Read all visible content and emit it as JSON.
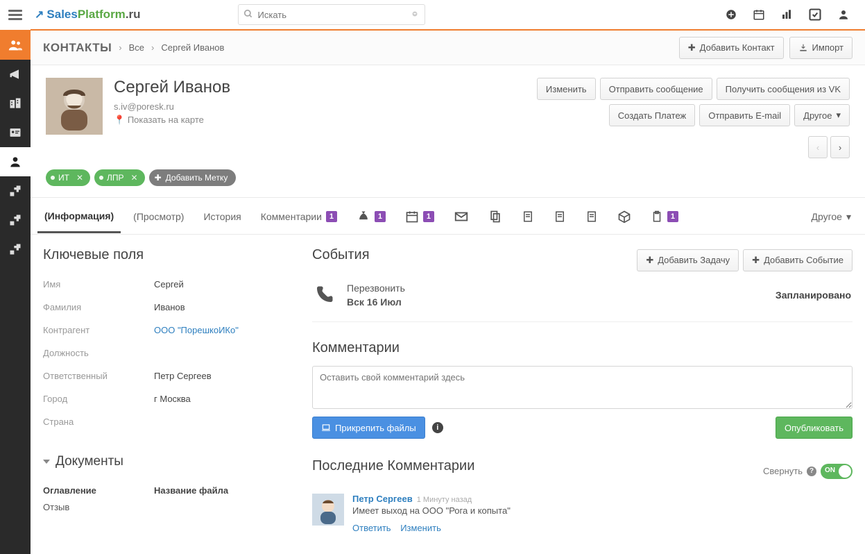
{
  "app": {
    "logo_sales": "Sales",
    "logo_platform": "Platform",
    "logo_ru": ".ru"
  },
  "search": {
    "placeholder": "Искать"
  },
  "crumb": {
    "module": "КОНТАКТЫ",
    "all": "Все",
    "person": "Сергей Иванов"
  },
  "header_buttons": {
    "add_contact": "Добавить Контакт",
    "import": "Импорт"
  },
  "contact": {
    "name": "Сергей Иванов",
    "email": "s.iv@poresk.ru",
    "map": "Показать на карте"
  },
  "actions": {
    "edit": "Изменить",
    "send_msg": "Отправить сообщение",
    "get_vk": "Получить сообщения из VK",
    "create_pay": "Создать Платеж",
    "send_email": "Отправить E-mail",
    "other": "Другое"
  },
  "tags": {
    "it": "ИТ",
    "lpr": "ЛПР",
    "add": "Добавить Метку"
  },
  "tabs": {
    "info": "(Информация)",
    "view": "(Просмотр)",
    "history": "История",
    "comments": "Комментарии",
    "comments_badge": "1",
    "money_badge": "1",
    "cal_badge": "1",
    "doc_badge": "1",
    "other": "Другое"
  },
  "keyfields": {
    "title": "Ключевые поля",
    "rows": [
      {
        "k": "Имя",
        "v": "Сергей"
      },
      {
        "k": "Фамилия",
        "v": "Иванов"
      },
      {
        "k": "Контрагент",
        "v": "ООО \"ПорешкоИКо\"",
        "link": true
      },
      {
        "k": "Должность",
        "v": ""
      },
      {
        "k": "Ответственный",
        "v": "Петр Сергеев"
      },
      {
        "k": "Город",
        "v": "г Москва"
      },
      {
        "k": "Страна",
        "v": ""
      }
    ]
  },
  "documents": {
    "title": "Документы",
    "col1_h": "Оглавление",
    "col2_h": "Название файла",
    "col1_v": "Отзыв"
  },
  "events": {
    "title": "События",
    "add_task": "Добавить Задачу",
    "add_event": "Добавить Событие",
    "item": {
      "title": "Перезвонить",
      "date": "Вск 16 Июл",
      "status": "Запланировано"
    }
  },
  "comments_panel": {
    "title": "Комментарии",
    "placeholder": "Оставить свой комментарий здесь",
    "attach": "Прикрепить файлы",
    "publish": "Опубликовать"
  },
  "recent": {
    "title": "Последние Комментарии",
    "collapse": "Свернуть",
    "switch": "ON",
    "author": "Петр Сергеев",
    "time": "1 Минуту назад",
    "msg": "Имеет выход на ООО \"Рога и копыта\"",
    "reply": "Ответить",
    "edit": "Изменить"
  }
}
